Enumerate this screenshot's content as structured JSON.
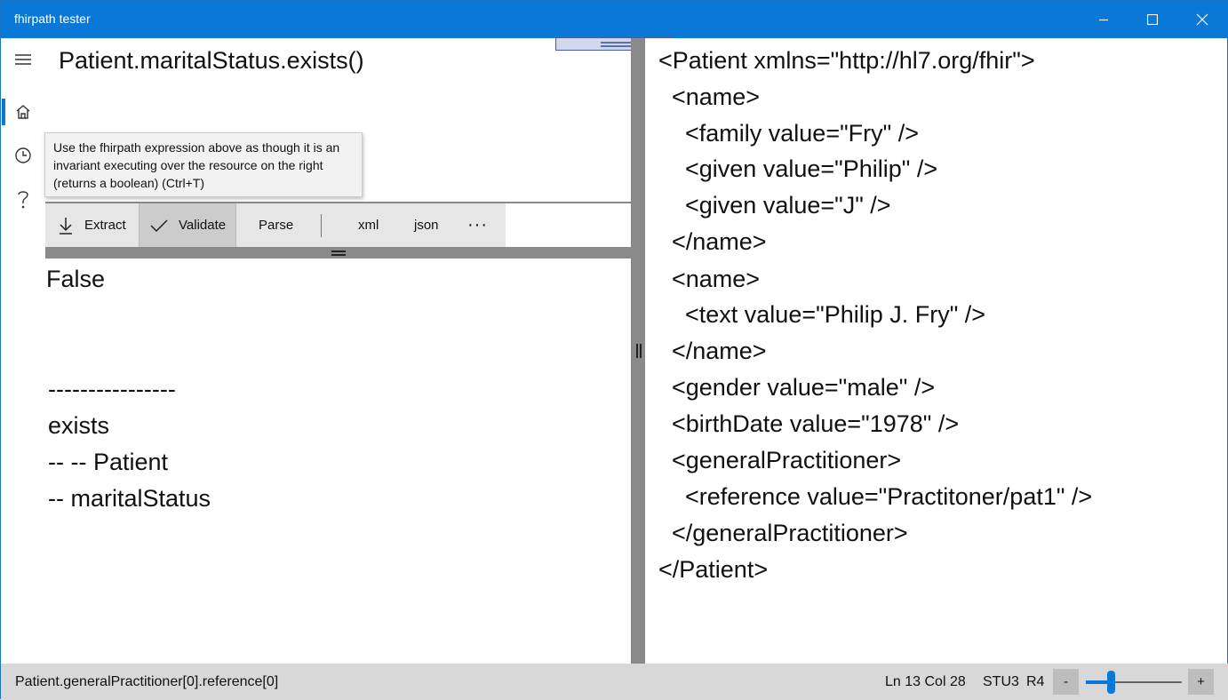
{
  "window": {
    "title": "fhirpath tester"
  },
  "rail": {
    "items": [
      "menu-icon",
      "home-icon",
      "history-icon",
      "help-icon"
    ]
  },
  "expression": {
    "value": "Patient.maritalStatus.exists()"
  },
  "tooltip": {
    "lines": [
      "Use the fhirpath expression above as though it is an",
      "invariant executing over the resource on the right",
      "(returns a boolean)  (Ctrl+T)"
    ]
  },
  "toolbar": {
    "extract_label": "Extract",
    "validate_label": "Validate",
    "parse_label": "Parse",
    "xml_label": "xml",
    "json_label": "json",
    "more_label": "···"
  },
  "result": {
    "lines": [
      "False",
      "",
      "",
      "----------------",
      "exists",
      "-- -- Patient",
      "-- maritalStatus"
    ]
  },
  "resource": {
    "lines": [
      "<Patient xmlns=\"http://hl7.org/fhir\">",
      "  <name>",
      "    <family value=\"Fry\" />",
      "    <given value=\"Philip\" />",
      "    <given value=\"J\" />",
      "  </name>",
      "  <name>",
      "    <text value=\"Philip J. Fry\" />",
      "  </name>",
      "  <gender value=\"male\" />",
      "  <birthDate value=\"1978\" />",
      "  <generalPractitioner>",
      "    <reference value=\"Practitoner/pat1\" />",
      "  </generalPractitioner>",
      "</Patient>"
    ]
  },
  "status": {
    "path": "Patient.generalPractitioner[0].reference[0]",
    "position": "Ln 13 Col 28",
    "version_stu3": "STU3",
    "version_r4": "R4",
    "zoom_out_label": "-",
    "zoom_in_label": "+",
    "zoom_level": 0.26
  },
  "colors": {
    "accent": "#0a78d7",
    "titlebar": "#0a78d7",
    "splitter": "#8a8a8a"
  }
}
